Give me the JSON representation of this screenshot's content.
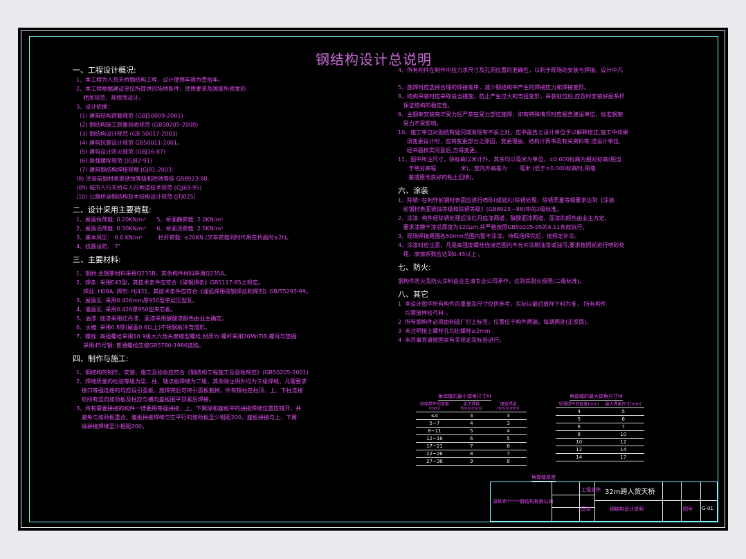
{
  "title": "钢结构设计总说明",
  "left_lines": [
    {
      "t": "一、工程设计概况:",
      "h": true
    },
    {
      "t": "  1、本工程为人货天桥钢结构工程，设计使用年限为壹拾年。"
    },
    {
      "t": "  2、本工程根据建设单位所提供的场地条件、使用要求及国家所颁发的"
    },
    {
      "t": "      相关规范、规程而设计。"
    },
    {
      "t": "  3、设计依据："
    },
    {
      "t": "    (1) 建筑结构荷载规范 (GBJ50009-2001)"
    },
    {
      "t": "    (2) 钢结构施工质量验收规范 (GB50205-2000)"
    },
    {
      "t": "    (3) 钢结构设计规范 (GB 50017-2003)"
    },
    {
      "t": "    (4) 建筑抗震设计规范 GB50011-2001。"
    },
    {
      "t": "    (5) 建筑设计防火规范 (GBJ16-87)"
    },
    {
      "t": "    (6) 高强螺栓规范 (JGJ82-91)"
    },
    {
      "t": "    (7) 建筑钢结构焊接规程 JGJ81-2003;"
    },
    {
      "t": "  (8) 涂装前钢材表面锈蚀等级和除锈等级 GB8923-88;"
    },
    {
      "t": "  (09) 城市人行天桥与人行地道技术规范 (CJJ69-95)"
    },
    {
      "t": "  (10) 公路桥涵钢结构及木结构设计规范 (JTJ025)"
    },
    {
      "sp": true
    },
    {
      "t": "二、设计采用主要荷载:",
      "h": true
    },
    {
      "t": "  1、屋面恒荷载: 0.20KN/m²      5、桥面静荷载: 2.0KN/m²"
    },
    {
      "t": "  2、屋面活荷载: 0.30KN/m²      6、桥面活荷载: 2.5KN/m²"
    },
    {
      "t": "  3、基本风压:   0.6 KN/m²         栏杆荷载: ≤20KN (叉车荷载同时作用在桥面时≤2t)。"
    },
    {
      "t": "  4、抗震设防:   7°"
    },
    {
      "sp": true
    },
    {
      "t": "三、主要材料:",
      "h": true
    },
    {
      "sp": true
    },
    {
      "t": "  1、钢材:主钢架材料采用Q235B，其余构件材料采用Q235A。"
    },
    {
      "t": "  2、焊条: 采用E43型，其技术条件应符合《碳钢焊条》GB5117-85之规定。"
    },
    {
      "t": "      焊丝: H08A; 焊剂: HJ431，其技术条件应符合《埋弧焊用碳钢焊丝和焊剂》GB/T5293-99。"
    },
    {
      "t": "  3、屋面瓦: 采用0.426mm厚950型单层压型瓦。"
    },
    {
      "t": "  4、墙面瓦: 采用0.426厚950型夹芯板。"
    },
    {
      "t": "  5、油漆: 底漆采用红丹漆，面漆采用醇酸漆颜色由业主确定。"
    },
    {
      "t": "  6、水槽: 采用0.8厚(屋面0.6以上)不锈钢板冷弯成形。"
    },
    {
      "t": "  7、螺栓: 高强螺栓采用10.9级大六角头摩擦型螺栓,材质为:螺杆采用20MnTiB,螺母与垫圈"
    },
    {
      "t": "      采用45号钢; 普通螺栓应按GB5780-1986选购。"
    },
    {
      "sp": true
    },
    {
      "t": "四、制作与施工:",
      "h": true
    },
    {
      "sp": true
    },
    {
      "t": "  1、钢结构的制作、安装、施工及验收应符合《钢结构工程施工及验收规范》(GB50205-2001)"
    },
    {
      "t": "  2、焊缝质量的检验等级为梁、柱、端点板焊缝为二级，其余除注明外均为三级焊缝，凡需要求"
    },
    {
      "t": "     接口等强连接的均应设引弧板，施焊完后可将引弧板割掉。所有钢柱在柱顶、上、下柱连接"
    },
    {
      "t": "     处所有竖向加劲板及柱应与横向盖板围平顶紧后焊接。"
    },
    {
      "t": "  3、所有需要拼接的构件一律要用等强拼接，上、下翼缘和腹板中的拼接焊缝位置应错开，并"
    },
    {
      "t": "     避免与加劲板重合，腹板拼接焊缝与它平行的加劲板至少相距200，腹板拼接与上、下翼"
    },
    {
      "t": "     缘拼接焊缝至少相距200。"
    }
  ],
  "right_lines": [
    {
      "t": "4、所有构件在制作中应力求尺寸及孔洞位置的准确性，以利于现场的安装与焊接。设计中凡"
    },
    {
      "sp": true
    },
    {
      "sp": true
    },
    {
      "t": "5、施焊时应选择合理的焊接顺序，减少钢结构中产生的焊接应力和焊接变形。"
    },
    {
      "t": "8、结构吊装时应采取适当措施，防止产生过大的弯扭变形，吊装就位后,应及时安装好屋系杆"
    },
    {
      "t": "   保证结构的稳定性。"
    },
    {
      "t": "9、主钢架安装完毕受力后严禁在受力部位施焊，如有特殊情况时应报告建设单位，标准钢架"
    },
    {
      "t": "   受力不受影响。"
    },
    {
      "t": "10、施工单位对图纸有疑问或发现有不妥之处，应书面告之设计单位予以解释修正,施工中如果"
    },
    {
      "t": "     须变更设计时，应将变更部分之原因、变更理由、结构计算书及有关资料等,送设计单位,"
    },
    {
      "t": "     经书面核实同意后,方得变更。"
    },
    {
      "t": "11、图中所注尺寸，除标高以米计外，其余均以毫米为单位，±0.000标高为相对标高(相当"
    },
    {
      "t": "      于绝对高程              米)，室内外高差为       毫米 (低于±0.000标高时,用墙"
    },
    {
      "t": "      基或原地良好的粘土回填)。"
    },
    {
      "sp": true
    },
    {
      "t": "六、涂装",
      "h": true
    },
    {
      "t": "1、除锈: 在制作前钢材表面应进行喷砂(或抛丸)除锈处理，除锈质量等级要求达到《涂装"
    },
    {
      "t": "   前钢材表面锈蚀等级和除锈等级》(GB8923－88)中的2级标准。"
    },
    {
      "t": "2、涂漆: 构件经除锈处理后涂红丹底漆两道，醇酸面漆两道，面漆的颜色由业主方定，"
    },
    {
      "t": "   要求漆膜干漆总厚度为120μm,并严格按照GB50205-95的4.11条款执行。"
    },
    {
      "t": "3、现场焊接周围各50mm范围内暂不涂漆，待现场焊完后，按规定补涂。"
    },
    {
      "t": "4、涂漆时应注意，凡是高强度螺栓连接范围内不允许涂刷油漆或油污,要求按照前进行喷砂处"
    },
    {
      "t": "   理，摩擦系数应达到0.45以上 。"
    },
    {
      "sp": true
    },
    {
      "t": "七、防火:",
      "h": true
    },
    {
      "sp": true
    },
    {
      "t": "钢构件防火及防火涂料由业主请专业公司承作，达到其耐火极限(二级标准)。"
    },
    {
      "sp": true
    },
    {
      "t": "八、其它",
      "h": true
    },
    {
      "t": "1  本设计图中所有构件的重量及尺寸仅供参考，实际以最后放样下料为准， 所有构件"
    },
    {
      "t": "    均需放样校弓料 。"
    },
    {
      "t": "2  所有钢构件必须由制造厂打上标签，位置位于构件两端，每端两处(正反面)。"
    },
    {
      "t": "3  未注明接上螺栓孔均比螺栓≥2mm."
    },
    {
      "t": "4  未尽事宜请按国家有关规定及标准进行。"
    }
  ],
  "table1": {
    "caption": "角焊缝的最小焊角尺寸hf",
    "headers": [
      "较厚焊件的厚度(mm)",
      "手工焊接Hmin(mm)",
      "埋弧焊接Hmin(mm)"
    ],
    "rows": [
      [
        "≤4",
        "4",
        "3"
      ],
      [
        "5~7",
        "4",
        "3"
      ],
      [
        "8~11",
        "5",
        "4"
      ],
      [
        "12~16",
        "6",
        "5"
      ],
      [
        "17~21",
        "7",
        "6"
      ],
      [
        "22~26",
        "8",
        "7"
      ],
      [
        "27~36",
        "9",
        "8"
      ]
    ]
  },
  "table2": {
    "caption": "角焊缝的最大焊角尺寸hf",
    "headers": [
      "较薄焊件的厚度(mm)",
      "最大焊角尺寸(mm)"
    ],
    "rows": [
      [
        "4",
        "5"
      ],
      [
        "5",
        "6"
      ],
      [
        "6",
        "7"
      ],
      [
        "8",
        "10"
      ],
      [
        "10",
        "12"
      ],
      [
        "12",
        "14"
      ],
      [
        "14",
        "17"
      ]
    ]
  },
  "table_note": "角焊缝厚度",
  "title_block": {
    "company": "深圳市*****钢结构有限公司",
    "project": "32m跨人货天桥",
    "drawing": "钢结构设计说明",
    "label1": "工程名称",
    "label2": "图名",
    "sheet_label": "图号",
    "sheet_no": "G-01"
  }
}
